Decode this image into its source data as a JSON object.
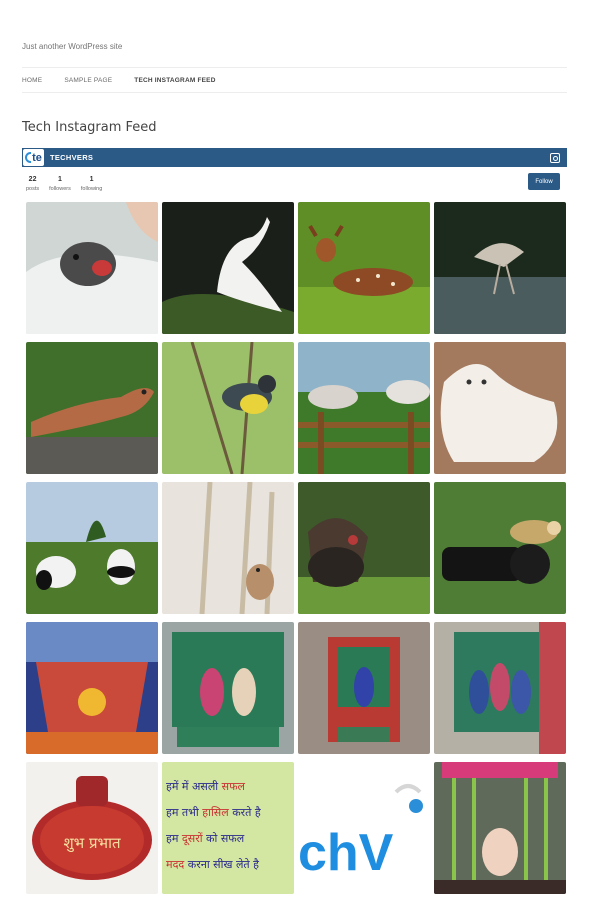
{
  "site": {
    "tagline": "Just another WordPress site"
  },
  "nav": {
    "items": [
      "HOME",
      "SAMPLE PAGE",
      "TECH INSTAGRAM FEED"
    ],
    "current_index": 2
  },
  "page": {
    "title": "Tech Instagram Feed"
  },
  "instagram": {
    "avatar_text": "te",
    "username": "TECHVERS",
    "stats": [
      {
        "value": "22",
        "label": "posts"
      },
      {
        "value": "1",
        "label": "followers"
      },
      {
        "value": "1",
        "label": "following"
      }
    ],
    "follow_label": "Follow",
    "header_color": "#2b5a87",
    "photos": [
      {
        "name": "bird-chick"
      },
      {
        "name": "white-egret"
      },
      {
        "name": "fawn-deer"
      },
      {
        "name": "heron-water"
      },
      {
        "name": "lizard"
      },
      {
        "name": "warbler-bird"
      },
      {
        "name": "horses-fence"
      },
      {
        "name": "white-lion"
      },
      {
        "name": "pandas"
      },
      {
        "name": "mouse-wheat"
      },
      {
        "name": "turkey"
      },
      {
        "name": "monkey-camera"
      },
      {
        "name": "temple-shrine-blue"
      },
      {
        "name": "temple-shrine-green"
      },
      {
        "name": "temple-shrine-red"
      },
      {
        "name": "temple-shrine-deities"
      },
      {
        "name": "puja-thali",
        "text": "शुभ प्रभात"
      },
      {
        "name": "hindi-quote",
        "text": "हमें में असली सफल / हम तभी हासिल करते है / हम दूसरों को सफल / मदद करना सीख लेते है"
      },
      {
        "name": "techvers-logo",
        "text": "chV"
      },
      {
        "name": "temple-decor"
      }
    ]
  }
}
